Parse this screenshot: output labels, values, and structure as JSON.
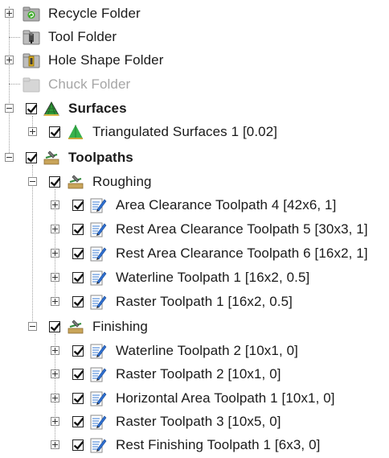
{
  "tree": {
    "folders": [
      {
        "label": "Recycle Folder",
        "icon": "recycle-folder-icon"
      },
      {
        "label": "Tool Folder",
        "icon": "tool-folder-icon"
      },
      {
        "label": "Hole Shape Folder",
        "icon": "hole-shape-folder-icon"
      },
      {
        "label": "Chuck Folder",
        "icon": "chuck-folder-icon",
        "disabled": true
      }
    ],
    "surfaces": {
      "label": "Surfaces",
      "checked": true,
      "children": [
        {
          "label": "Triangulated Surfaces 1 [0.02]",
          "checked": true
        }
      ]
    },
    "toolpaths": {
      "label": "Toolpaths",
      "checked": true,
      "roughing": {
        "label": "Roughing",
        "checked": true,
        "items": [
          {
            "label": "Area Clearance Toolpath 4 [42x6, 1]",
            "checked": true
          },
          {
            "label": "Rest Area Clearance Toolpath 5 [30x3, 1]",
            "checked": true
          },
          {
            "label": "Rest Area Clearance Toolpath 6 [16x2, 1]",
            "checked": true
          },
          {
            "label": "Waterline Toolpath 1 [16x2, 0.5]",
            "checked": true
          },
          {
            "label": "Raster Toolpath 1 [16x2, 0.5]",
            "checked": true
          }
        ]
      },
      "finishing": {
        "label": "Finishing",
        "checked": true,
        "items": [
          {
            "label": "Waterline Toolpath 2 [10x1, 0]",
            "checked": true
          },
          {
            "label": "Raster Toolpath 2 [10x1, 0]",
            "checked": true
          },
          {
            "label": "Horizontal Area Toolpath 1 [10x1, 0]",
            "checked": true
          },
          {
            "label": "Raster Toolpath 3 [10x5, 0]",
            "checked": true
          },
          {
            "label": "Rest Finishing Toolpath 1 [6x3, 0]",
            "checked": true
          }
        ]
      }
    }
  }
}
